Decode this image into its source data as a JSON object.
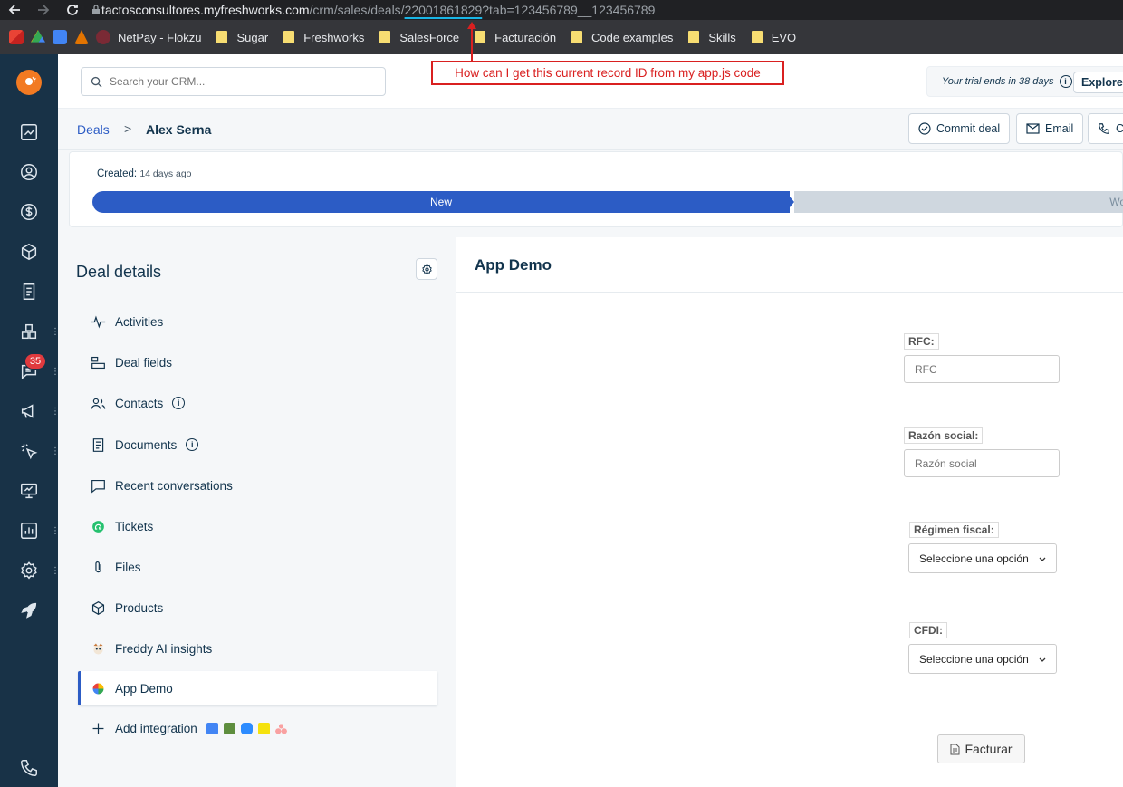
{
  "browser": {
    "url_host": "tactosconsultores.myfreshworks.com",
    "url_path": "/crm/sales/deals/",
    "url_record_id": "22001861829",
    "url_query": "?tab=123456789__123456789",
    "bookmarks": [
      {
        "label": "NetPay - Flokzu"
      },
      {
        "label": "Sugar"
      },
      {
        "label": "Freshworks"
      },
      {
        "label": "SalesForce"
      },
      {
        "label": "Facturación"
      },
      {
        "label": "Code examples"
      },
      {
        "label": "Skills"
      },
      {
        "label": "EVO"
      }
    ]
  },
  "annotation": {
    "text": "How can I get this current record ID from my app.js code",
    "color": "#d92020"
  },
  "header": {
    "search_placeholder": "Search your CRM...",
    "trial_text": "Your trial ends in 38 days",
    "explore_label": "Explore"
  },
  "nav": {
    "badge_count": "35",
    "items": [
      "deals-icon",
      "contacts-icon",
      "dollar-icon",
      "products-icon",
      "documents-icon",
      "apps-icon",
      "chat-icon",
      "campaigns-icon",
      "sequences-icon",
      "workflows-icon",
      "reports-icon",
      "settings-icon",
      "rocket-icon",
      "phone-icon"
    ]
  },
  "breadcrumb": {
    "root": "Deals",
    "separator": ">",
    "current": "Alex Serna"
  },
  "actions": {
    "commit_deal": "Commit deal",
    "email": "Email",
    "call": "C"
  },
  "stage": {
    "created_label": "Created:",
    "created_value": "14 days ago",
    "current_stage": "New",
    "next_stage": "Wor",
    "accent": "#2c5cc5"
  },
  "details": {
    "title": "Deal details",
    "items": [
      {
        "label": "Activities"
      },
      {
        "label": "Deal fields"
      },
      {
        "label": "Contacts",
        "info": "i"
      },
      {
        "label": "Documents",
        "info": "i"
      },
      {
        "label": "Recent conversations"
      },
      {
        "label": "Tickets"
      },
      {
        "label": "Files"
      },
      {
        "label": "Products"
      },
      {
        "label": "Freddy AI insights"
      },
      {
        "label": "App Demo"
      },
      {
        "label": "Add integration"
      }
    ]
  },
  "app": {
    "title": "App Demo",
    "rfc_label": "RFC:",
    "rfc_placeholder": "RFC",
    "razon_label": "Razón social:",
    "razon_placeholder": "Razón social",
    "regimen_label": "Régimen fiscal:",
    "regimen_value": "Seleccione una opción",
    "cfdi_label": "CFDI:",
    "cfdi_value": "Seleccione una opción",
    "facturar_label": "Facturar"
  }
}
